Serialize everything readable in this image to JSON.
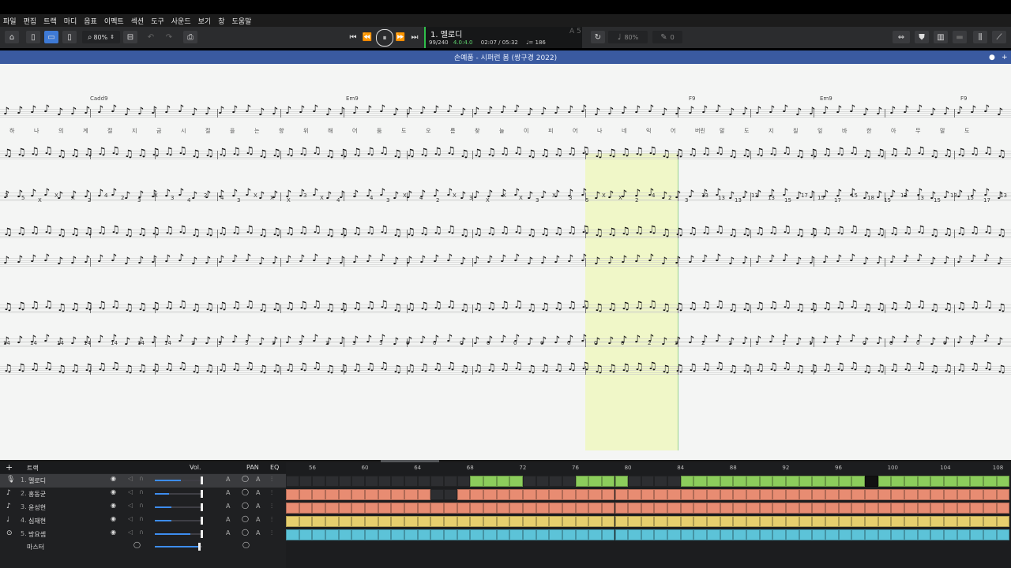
{
  "menu": [
    "파일",
    "편집",
    "트랙",
    "마디",
    "음표",
    "이펙트",
    "섹션",
    "도구",
    "사운드",
    "보기",
    "창",
    "도움말"
  ],
  "toolbar": {
    "zoom": "80%",
    "tempo_zoom": "80%",
    "zero": "0"
  },
  "transport": {
    "track_name": "1. 멜로디",
    "bar_position": "99/240",
    "time_sig": "4.0:4.0",
    "time": "02:07 / 05:32",
    "tempo": "♩= 186",
    "A5": "A 5"
  },
  "document": {
    "title": "손예품 - 시퍼런 봄 (쌍구경 2022)"
  },
  "chords": [
    {
      "label": "Cadd9"
    },
    {
      "label": "Em9"
    },
    {
      "label": "F9"
    },
    {
      "label": "Em9"
    },
    {
      "label": "F9"
    }
  ],
  "lyrics": [
    "하",
    "나",
    "의",
    "계",
    "절",
    "지",
    "금",
    "시",
    "절",
    "을",
    "는",
    "향",
    "위",
    "해",
    "어",
    "둠",
    "도",
    "오",
    "름",
    "찾",
    "늘",
    "이",
    "피",
    "어",
    "나",
    "네",
    "익",
    "어",
    "버린",
    "말",
    "도",
    "지",
    "칠",
    "잎",
    "바",
    "한",
    "아",
    "무",
    "말",
    "도"
  ],
  "tab_numbers": {
    "row1": [
      "3",
      "5",
      "X",
      "X",
      "X",
      "2",
      "4",
      "2",
      "3",
      "X",
      "3",
      "4",
      "2",
      "4",
      "3",
      "X",
      "X",
      "X",
      "3",
      "X",
      "4",
      "2",
      "4",
      "3",
      "X",
      "4",
      "2",
      "X",
      "3",
      "X",
      "X",
      "X",
      "3",
      "X",
      "3",
      "5",
      "X",
      "X",
      "2",
      "4",
      "2",
      "3",
      "13",
      "13",
      "13",
      "13",
      "13",
      "15",
      "17",
      "15",
      "17",
      "15",
      "18",
      "15",
      "13",
      "13",
      "15",
      "13",
      "15",
      "17",
      "13"
    ],
    "row2": [
      "14",
      "14",
      "14",
      "14",
      "14",
      "14",
      "14",
      "3",
      "3",
      "3",
      "3",
      "3",
      "3",
      "3",
      "3",
      "0",
      "0",
      "0",
      "0",
      "0",
      "0",
      "0",
      "0",
      "0",
      "2",
      "3",
      "2",
      "1",
      "1",
      "1",
      "1",
      "1",
      "0",
      "0",
      "0",
      "0",
      "0"
    ]
  },
  "tracks": [
    {
      "num": "1.",
      "name": "멜로디",
      "icon": "mic-icon",
      "selected": true,
      "vol": 0.55
    },
    {
      "num": "2.",
      "name": "홍동균",
      "icon": "guitar-icon",
      "selected": false,
      "vol": 0.3
    },
    {
      "num": "3.",
      "name": "윤성현",
      "icon": "guitar-icon",
      "selected": false,
      "vol": 0.35
    },
    {
      "num": "4.",
      "name": "심재현",
      "icon": "bass-icon",
      "selected": false,
      "vol": 0.35
    },
    {
      "num": "5.",
      "name": "방요셉",
      "icon": "drums-icon",
      "selected": false,
      "vol": 0.75
    }
  ],
  "track_panel": {
    "header_label": "트랙",
    "vol_label": "Vol.",
    "pan_label": "PAN",
    "eq_label": "EQ",
    "master_label": "마스터"
  },
  "timeline": {
    "bar_numbers": [
      "56",
      "60",
      "64",
      "68",
      "72",
      "76",
      "80",
      "84",
      "88",
      "92",
      "96",
      "100",
      "104",
      "108"
    ],
    "colors": {
      "melody": "#8ccd5c",
      "guitar1": "#e88c72",
      "guitar2": "#e88c72",
      "bass": "#e6cf6e",
      "drums": "#5cc3d8",
      "empty": "#2d2e31"
    }
  }
}
